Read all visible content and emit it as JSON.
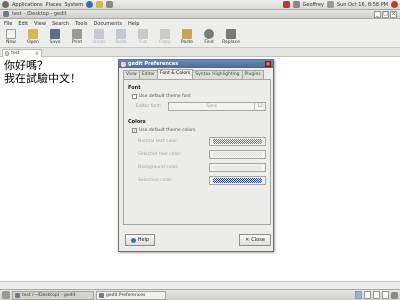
{
  "top_panel": {
    "applications": "Applications",
    "places": "Places",
    "system": "System",
    "user": "Geoffrey",
    "time": "Sun Oct 16, 8:58 PM"
  },
  "window": {
    "title": "test - /Desktop - gedit"
  },
  "menubar": [
    "File",
    "Edit",
    "View",
    "Search",
    "Tools",
    "Documents",
    "Help"
  ],
  "toolbar": {
    "new": "New",
    "open": "Open",
    "save": "Save",
    "print": "Print",
    "undo": "Undo",
    "redo": "Redo",
    "cut": "Cut",
    "copy": "Copy",
    "paste": "Paste",
    "find": "Find",
    "replace": "Replace"
  },
  "doc_tab": {
    "name": "test"
  },
  "editor": {
    "line1": "你好嗎？",
    "line2": "我在試驗中文！"
  },
  "dialog": {
    "title": "gedit Preferences",
    "tabs": [
      "View",
      "Editor",
      "Font & Colors",
      "Syntax Highlighting",
      "Plugins"
    ],
    "font_section": "Font",
    "use_default_font": "Use default theme font",
    "editor_font_label": "Editor font:",
    "font_name": "Sans",
    "font_size": "12",
    "colors_section": "Colors",
    "use_default_colors": "Use default theme colors",
    "color_rows": [
      "Normal text color:",
      "Selected text color:",
      "Background color:",
      "Selection color:"
    ],
    "help": "Help",
    "close": "Close"
  },
  "taskbar": {
    "task1": "test (~/Desktop) - gedit",
    "task2": "gedit Preferences"
  },
  "colors": {
    "title_bar": "#4a6b97",
    "selection_swatch": "#2a3ea8"
  }
}
